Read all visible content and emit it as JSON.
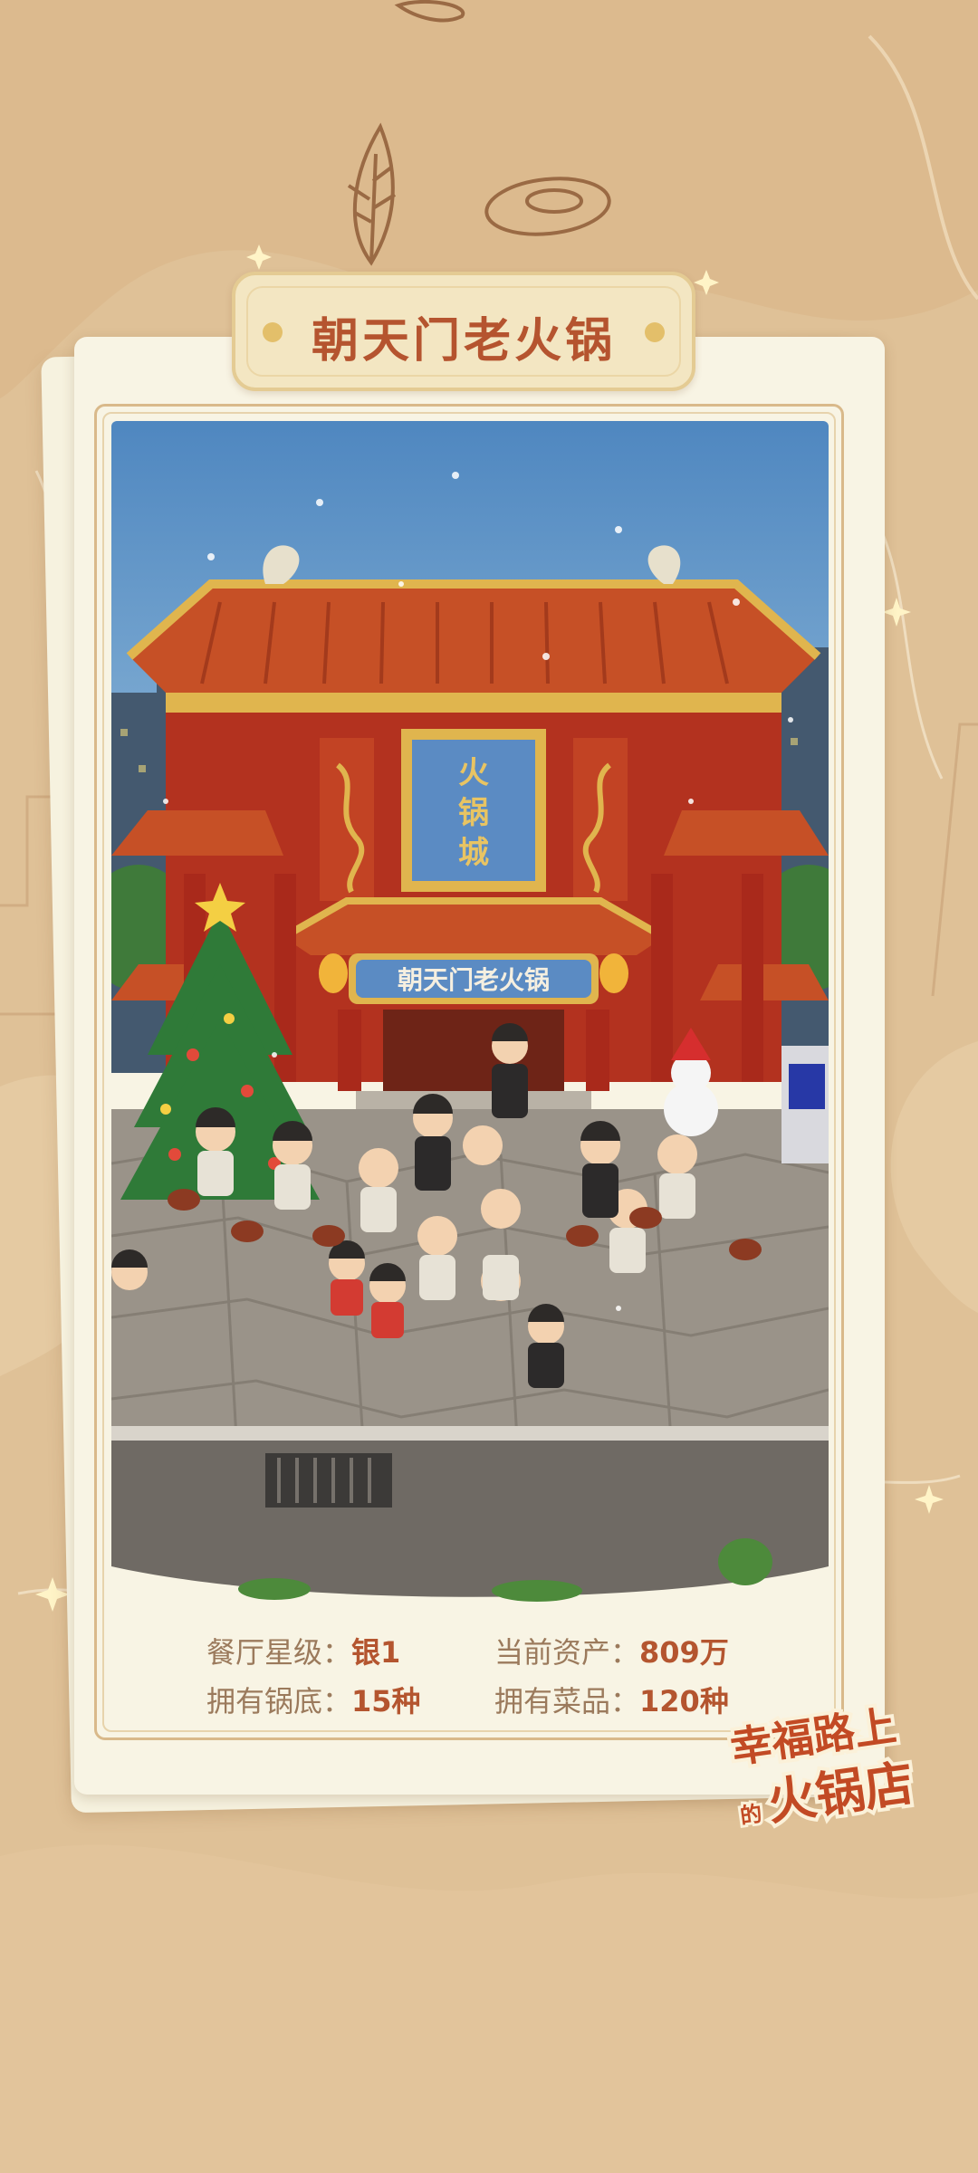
{
  "title": "朝天门老火锅",
  "scene": {
    "gate_sign": "火锅城",
    "restaurant_sign": "朝天门老火锅"
  },
  "stats": {
    "star_label": "餐厅星级：",
    "star_value": "银1",
    "assets_label": "当前资产：",
    "assets_value": "809万",
    "pots_label": "拥有锅底：",
    "pots_value": "15种",
    "dishes_label": "拥有菜品：",
    "dishes_value": "120种"
  },
  "logo": {
    "line1": "幸福路上",
    "small": "的",
    "line2": "火锅店"
  },
  "colors": {
    "background": "#dfc197",
    "card": "#f8f4e4",
    "title_text": "#b5542f",
    "label_text": "#9b7a5c",
    "value_text": "#b4552f"
  },
  "icons": [
    "leaf-icon",
    "oyster-icon",
    "sparkle-icon"
  ]
}
